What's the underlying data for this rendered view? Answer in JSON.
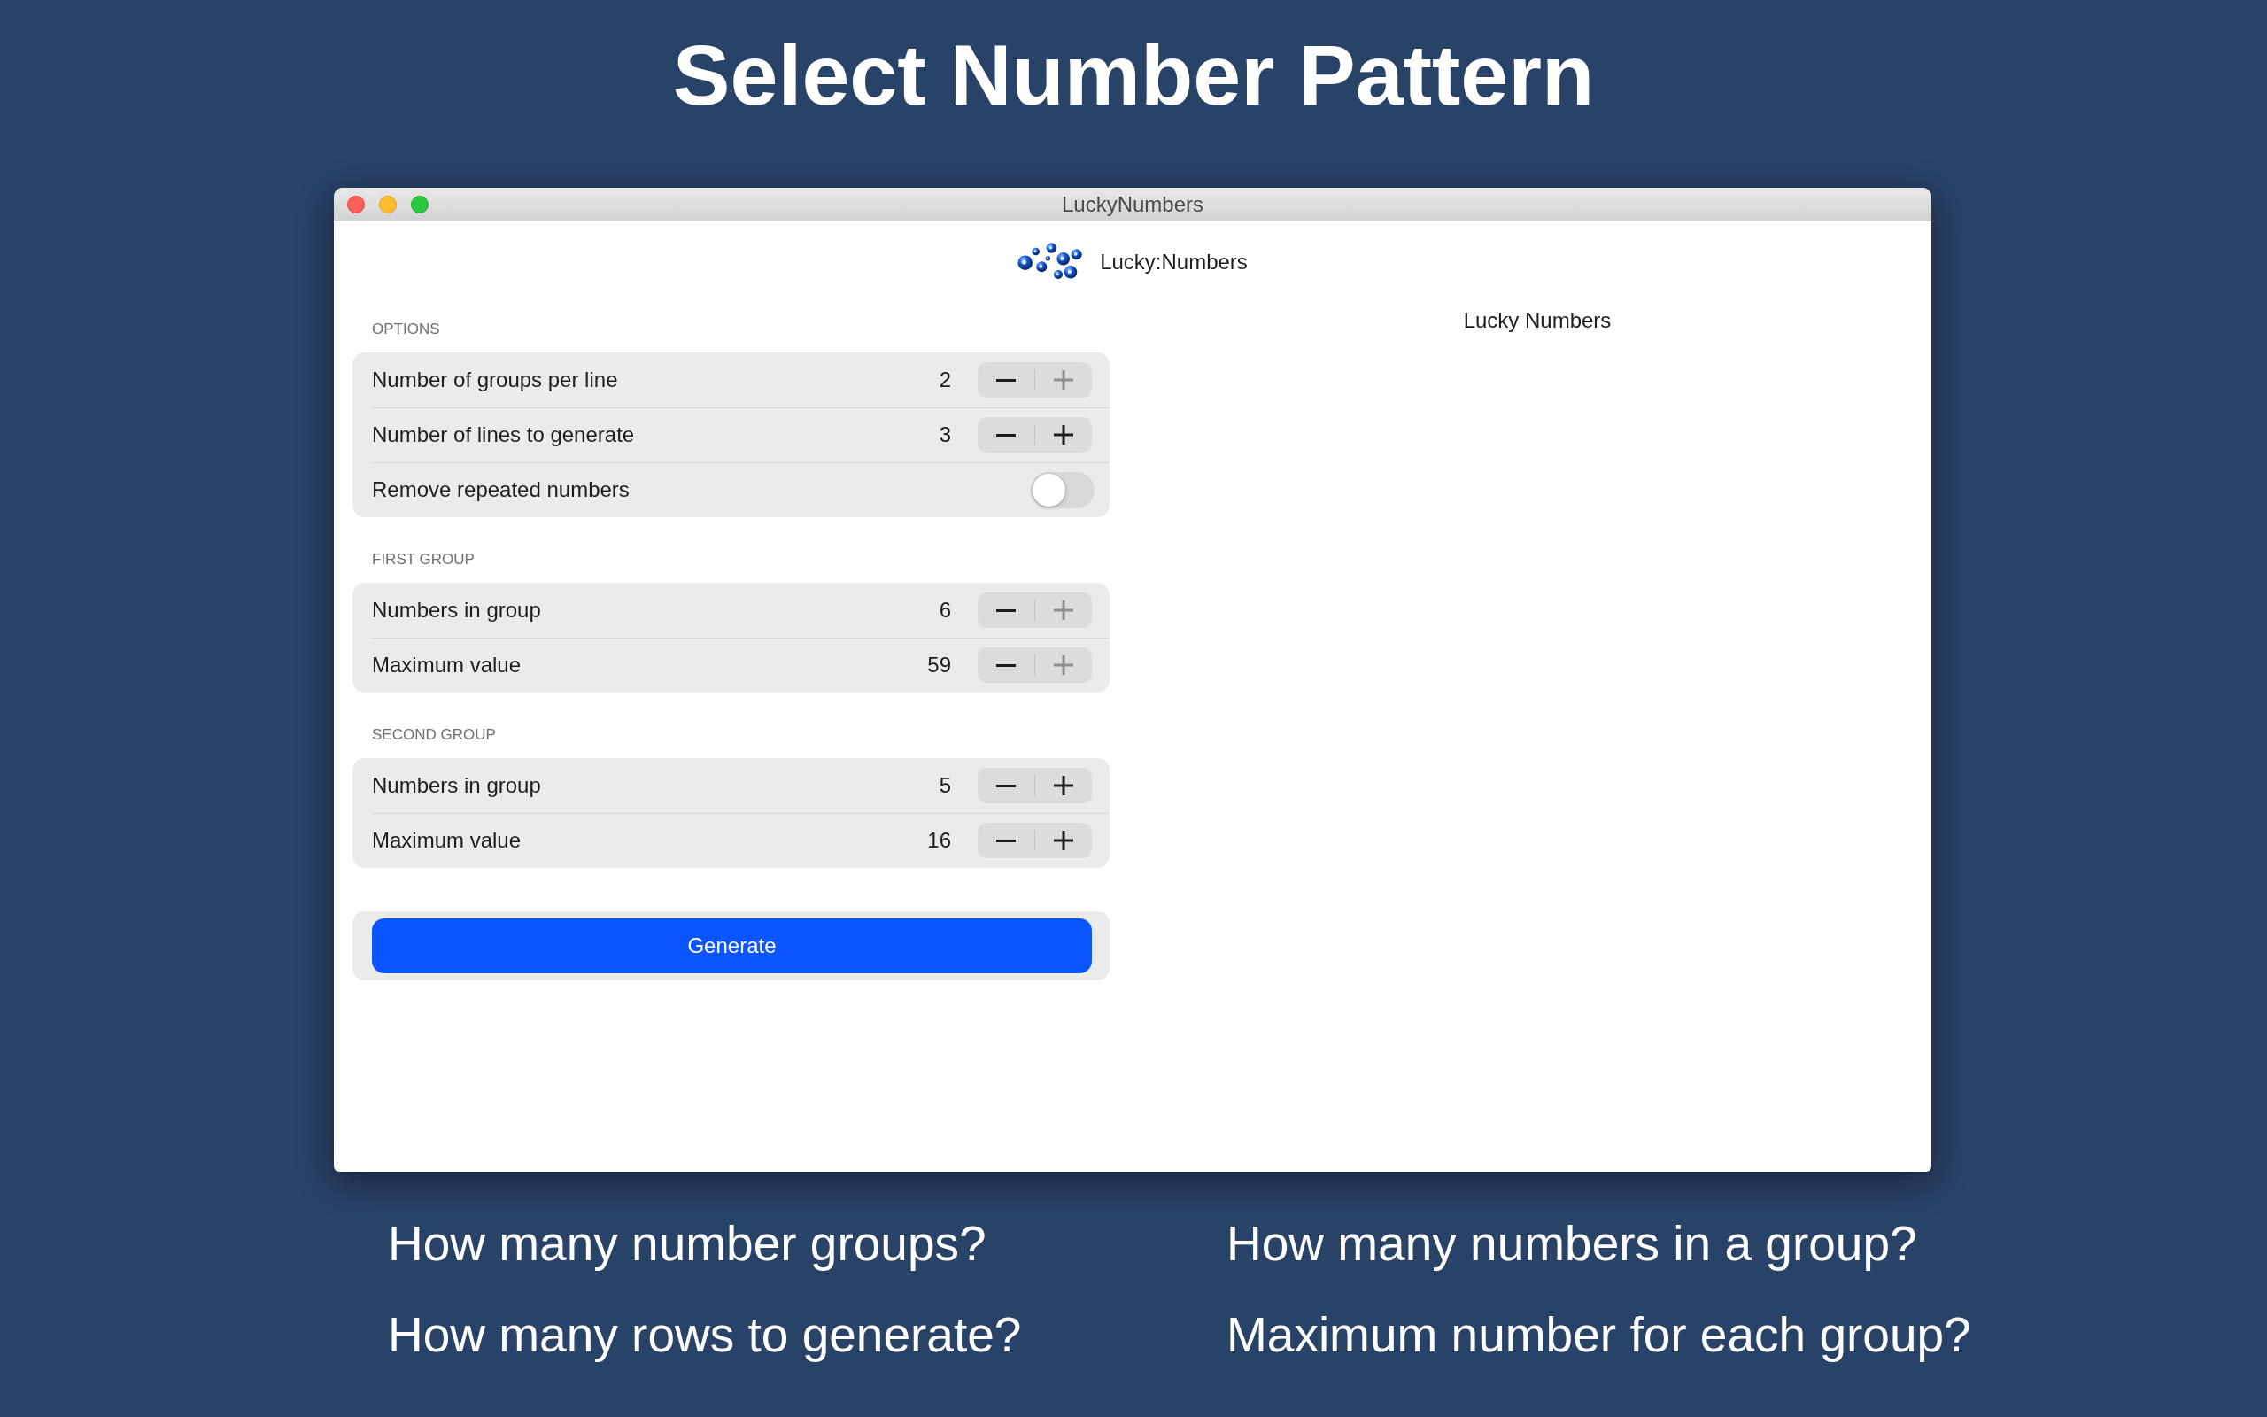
{
  "headline": "Select Number Pattern",
  "window": {
    "title": "LuckyNumbers"
  },
  "app_header": {
    "title": "Lucky:Numbers"
  },
  "sections": [
    {
      "heading": "OPTIONS",
      "rows": [
        {
          "kind": "stepper",
          "label": "Number of groups per line",
          "value": "2",
          "plus_disabled": true
        },
        {
          "kind": "stepper",
          "label": "Number of lines to generate",
          "value": "3",
          "plus_disabled": false
        },
        {
          "kind": "toggle",
          "label": "Remove repeated numbers",
          "on": false
        }
      ]
    },
    {
      "heading": "FIRST GROUP",
      "rows": [
        {
          "kind": "stepper",
          "label": "Numbers in group",
          "value": "6",
          "plus_disabled": true
        },
        {
          "kind": "stepper",
          "label": "Maximum value",
          "value": "59",
          "plus_disabled": true
        }
      ]
    },
    {
      "heading": "SECOND GROUP",
      "rows": [
        {
          "kind": "stepper",
          "label": "Numbers in group",
          "value": "5",
          "plus_disabled": false
        },
        {
          "kind": "stepper",
          "label": "Maximum value",
          "value": "16",
          "plus_disabled": false
        }
      ]
    }
  ],
  "generate_button": "Generate",
  "results": {
    "title": "Lucky Numbers"
  },
  "captions": [
    "How many number groups?",
    "How many numbers in a group?",
    "How many rows to generate?",
    "Maximum number for each group?"
  ]
}
